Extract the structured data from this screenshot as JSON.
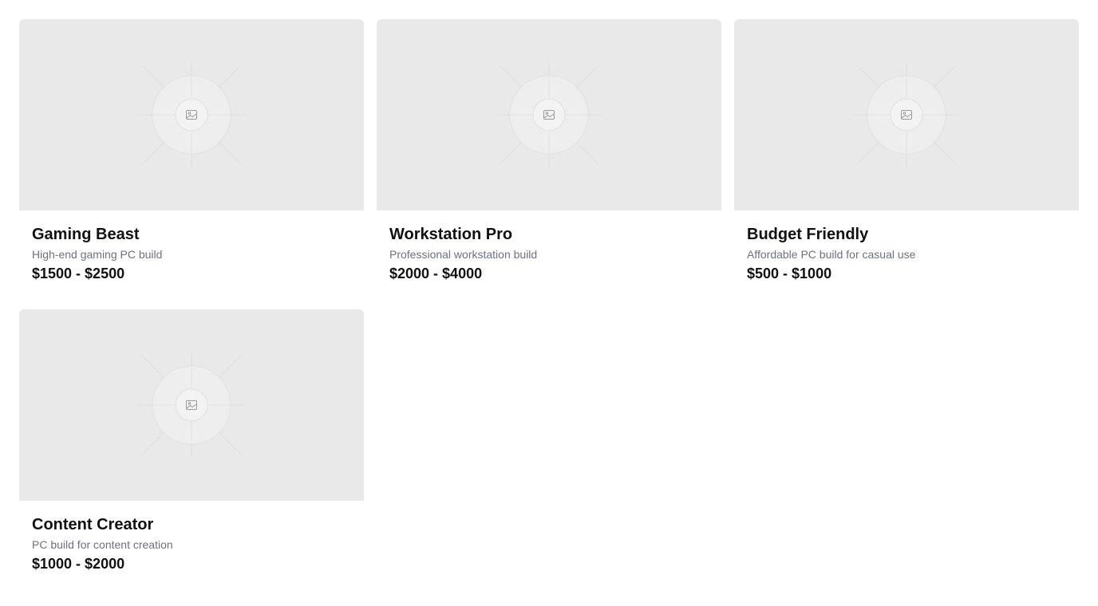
{
  "builds": [
    {
      "title": "Gaming Beast",
      "description": "High-end gaming PC build",
      "price": "$1500 - $2500",
      "image_icon": "image-placeholder-icon"
    },
    {
      "title": "Workstation Pro",
      "description": "Professional workstation build",
      "price": "$2000 - $4000",
      "image_icon": "image-placeholder-icon"
    },
    {
      "title": "Budget Friendly",
      "description": "Affordable PC build for casual use",
      "price": "$500 - $1000",
      "image_icon": "image-placeholder-icon"
    },
    {
      "title": "Content Creator",
      "description": "PC build for content creation",
      "price": "$1000 - $2000",
      "image_icon": "image-placeholder-icon"
    }
  ],
  "colors": {
    "placeholder_bg": "#e9e9e9",
    "title_text": "#111111",
    "description_text": "#6b7280"
  }
}
